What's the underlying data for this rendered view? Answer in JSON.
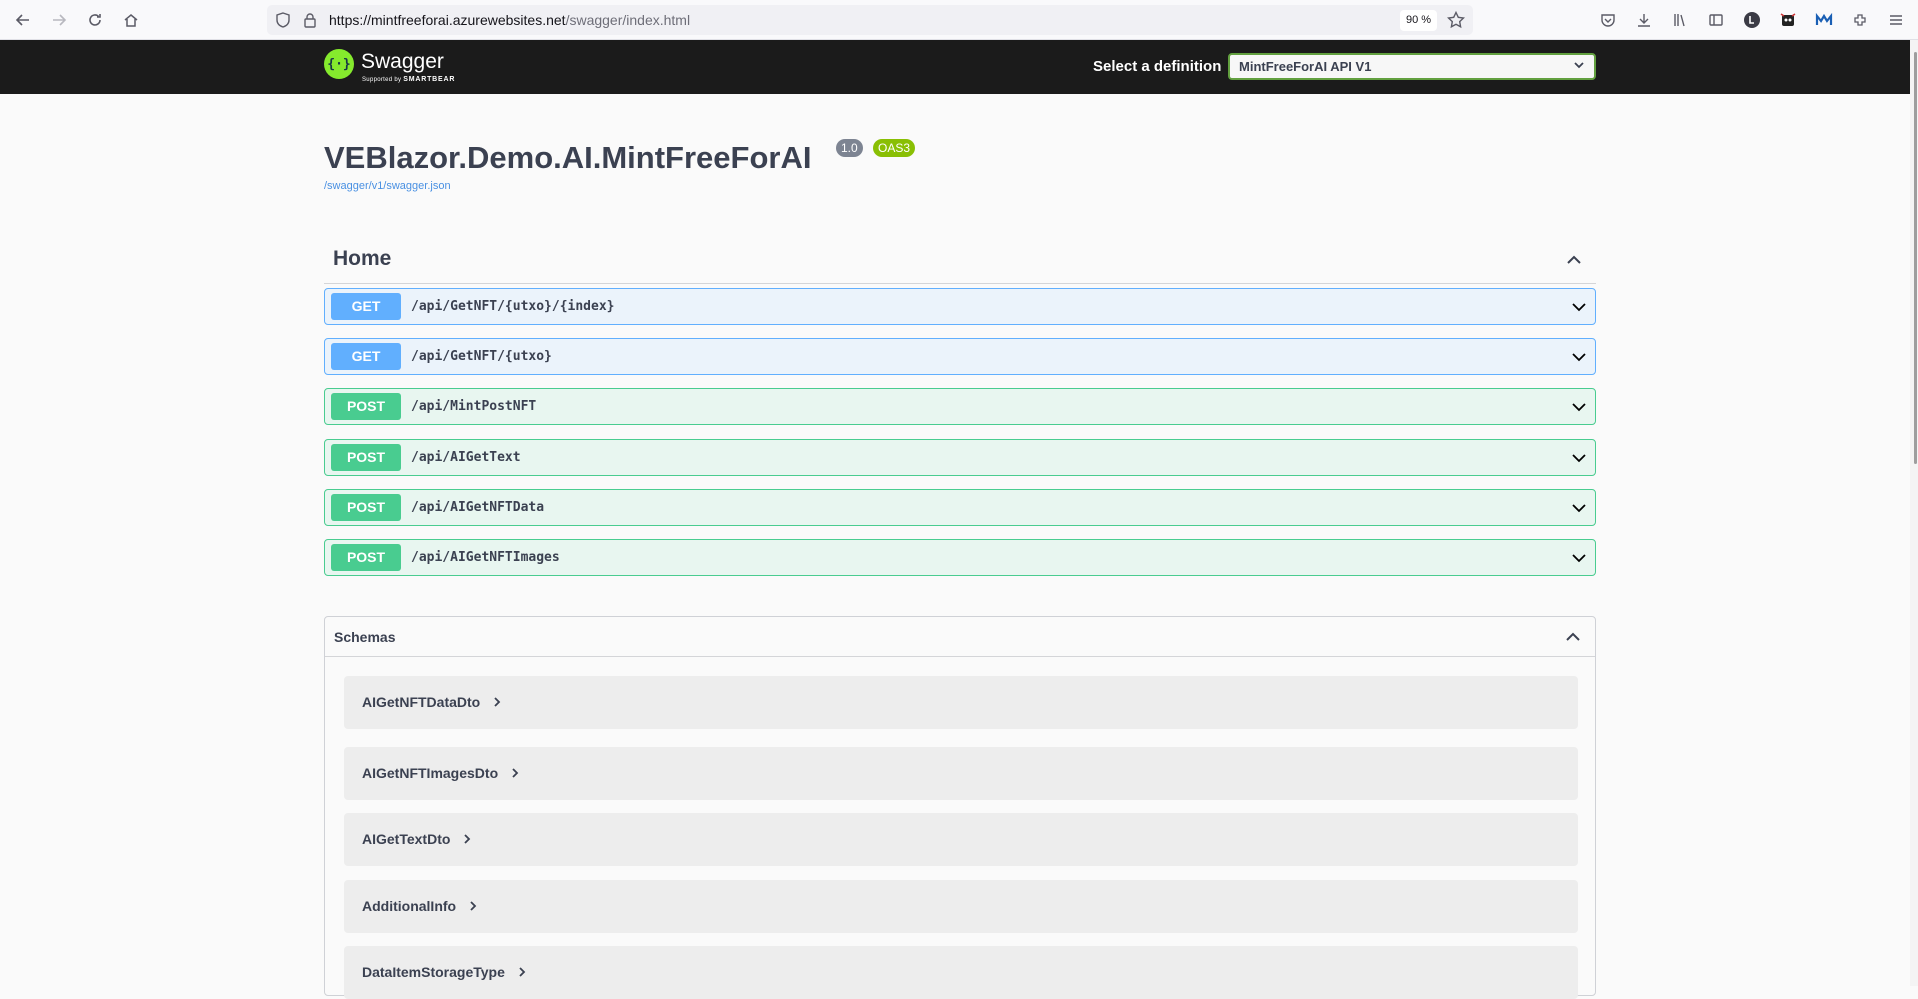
{
  "browser": {
    "url_host": "https://mintfreeforai.azurewebsites.net",
    "url_path": "/swagger/index.html",
    "zoom": "90 %"
  },
  "topbar": {
    "logo_title": "Swagger",
    "logo_sub_prefix": "Supported by",
    "logo_sub_brand": "SMARTBEAR",
    "select_label": "Select a definition",
    "selected_definition": "MintFreeForAI API V1"
  },
  "info": {
    "title": "VEBlazor.Demo.AI.MintFreeForAI",
    "version": "1.0",
    "oas": "OAS3",
    "spec_url": "/swagger/v1/swagger.json"
  },
  "tag": {
    "name": "Home"
  },
  "operations": [
    {
      "method": "GET",
      "path": "/api/GetNFT/{utxo}/{index}"
    },
    {
      "method": "GET",
      "path": "/api/GetNFT/{utxo}"
    },
    {
      "method": "POST",
      "path": "/api/MintPostNFT"
    },
    {
      "method": "POST",
      "path": "/api/AIGetText"
    },
    {
      "method": "POST",
      "path": "/api/AIGetNFTData"
    },
    {
      "method": "POST",
      "path": "/api/AIGetNFTImages"
    }
  ],
  "schemas": {
    "title": "Schemas",
    "models": [
      "AIGetNFTDataDto",
      "AIGetNFTImagesDto",
      "AIGetTextDto",
      "AdditionalInfo",
      "DataItemStorageType"
    ]
  },
  "colors": {
    "get": "#61affe",
    "post": "#49cc90",
    "topbar": "#1b1b1b",
    "accent": "#85ea2d"
  }
}
